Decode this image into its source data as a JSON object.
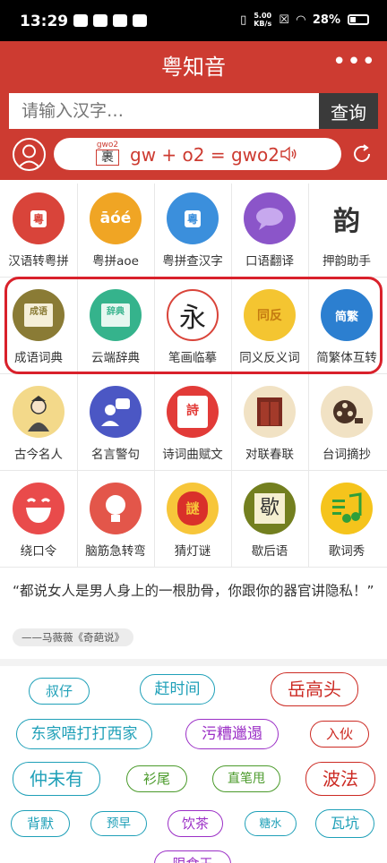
{
  "status_bar": {
    "time": "13:29",
    "net_speed_top": "5.00",
    "net_speed_bottom": "KB/s",
    "battery": "28%"
  },
  "header": {
    "title": "粤知音",
    "more_label": "•••"
  },
  "search": {
    "placeholder": "请输入汉字…",
    "button_label": "查询"
  },
  "pronunciation": {
    "jyutping_small": "gwo2",
    "char": "裹",
    "formula": "gw + o2 = gwo2"
  },
  "features": [
    {
      "label": "汉语转粤拼",
      "icon": "hanyu-to-jyutping-icon",
      "glyph": "粵",
      "color": "#d9443a"
    },
    {
      "label": "粤拼aoe",
      "icon": "jyutping-aoe-icon",
      "glyph": "āóé",
      "color": "#f0a524"
    },
    {
      "label": "粤拼查汉字",
      "icon": "jyutping-lookup-icon",
      "glyph": "粵",
      "color": "#3b8fdc"
    },
    {
      "label": "口语翻译",
      "icon": "speech-bubble-icon",
      "glyph": "",
      "color": "#8b55c9"
    },
    {
      "label": "押韵助手",
      "icon": "rhyme-icon",
      "glyph": "韵",
      "color": "#ffffff"
    },
    {
      "label": "成语词典",
      "icon": "idiom-book-icon",
      "glyph": "成语",
      "color": "#8a7b35"
    },
    {
      "label": "云端辞典",
      "icon": "cloud-dictionary-icon",
      "glyph": "辞典",
      "color": "#35b38c"
    },
    {
      "label": "笔画临摹",
      "icon": "brush-stroke-icon",
      "glyph": "永",
      "color": "#ffffff"
    },
    {
      "label": "同义反义词",
      "icon": "synonym-antonym-icon",
      "glyph": "同反",
      "color": "#f4c531"
    },
    {
      "label": "简繁体互转",
      "icon": "simplified-traditional-icon",
      "glyph": "简繁",
      "color": "#2c7fd0"
    },
    {
      "label": "古今名人",
      "icon": "famous-person-icon",
      "glyph": "",
      "color": "#f3d98a"
    },
    {
      "label": "名言警句",
      "icon": "quote-speaker-icon",
      "glyph": "",
      "color": "#4b57c4"
    },
    {
      "label": "诗词曲赋文",
      "icon": "poetry-icon",
      "glyph": "詩",
      "color": "#e23b38"
    },
    {
      "label": "对联春联",
      "icon": "couplet-door-icon",
      "glyph": "",
      "color": "#f1e2c4"
    },
    {
      "label": "台词摘抄",
      "icon": "film-reel-icon",
      "glyph": "",
      "color": "#f1e2c4"
    },
    {
      "label": "绕口令",
      "icon": "laughing-face-icon",
      "glyph": "",
      "color": "#e94b4b"
    },
    {
      "label": "脑筋急转弯",
      "icon": "lightbulb-icon",
      "glyph": "",
      "color": "#e3564a"
    },
    {
      "label": "猜灯谜",
      "icon": "lantern-icon",
      "glyph": "謎",
      "color": "#f7c63a"
    },
    {
      "label": "歇后语",
      "icon": "xiehouyu-icon",
      "glyph": "歇",
      "color": "#737f1f"
    },
    {
      "label": "歌词秀",
      "icon": "music-note-icon",
      "glyph": "",
      "color": "#f5c41c"
    }
  ],
  "quote": {
    "text": "“都说女人是男人身上的一根肋骨，你跟你的器官讲隐私！”",
    "source": "——马薇薇《奇葩说》"
  },
  "tags": [
    {
      "label": "叔仔",
      "color": "#1fa0b8"
    },
    {
      "label": "赶时间",
      "color": "#1fa0b8"
    },
    {
      "label": "岳高头",
      "color": "#cc2a23"
    },
    {
      "label": "东家唔打打西家",
      "color": "#1fa0b8"
    },
    {
      "label": "污糟邋遢",
      "color": "#9b2fc6"
    },
    {
      "label": "入伙",
      "color": "#cc2a23"
    },
    {
      "label": "仲未有",
      "color": "#1fa0b8"
    },
    {
      "label": "衫尾",
      "color": "#4a9a2a"
    },
    {
      "label": "直笔甩",
      "color": "#4a9a2a"
    },
    {
      "label": "波法",
      "color": "#cc2a23"
    },
    {
      "label": "背默",
      "color": "#1fa0b8"
    },
    {
      "label": "预早",
      "color": "#1fa0b8"
    },
    {
      "label": "饮茶",
      "color": "#9b2fc6"
    },
    {
      "label": "糖水",
      "color": "#1fa0b8"
    },
    {
      "label": "瓦坑",
      "color": "#1fa0b8"
    },
    {
      "label": "限食王",
      "color": "#9b2fc6"
    }
  ]
}
